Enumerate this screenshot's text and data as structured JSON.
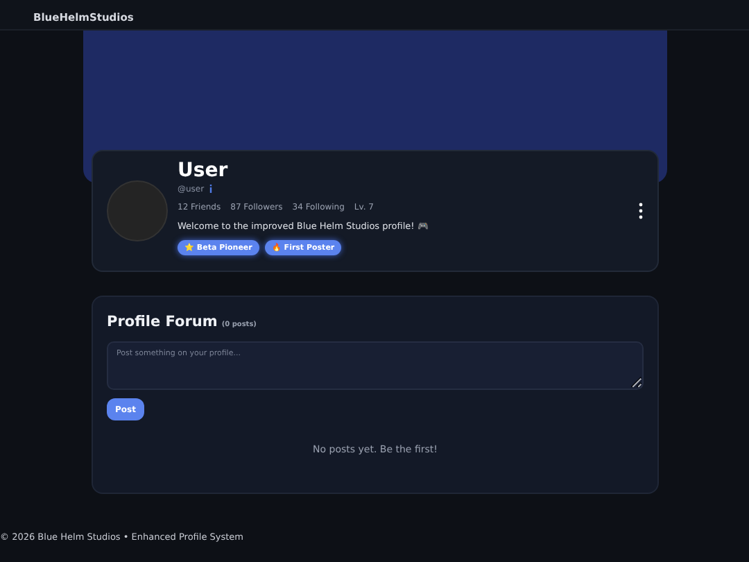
{
  "nav": {
    "brand": "BlueHelmStudios"
  },
  "profile": {
    "name": "User",
    "handle": "@user",
    "stats": [
      "12 Friends",
      "87 Followers",
      "34 Following",
      "Lv. 7"
    ],
    "bio": "Welcome to the improved Blue Helm Studios profile! 🎮",
    "badges": [
      {
        "label": "⭐ Beta Pioneer"
      },
      {
        "label": "🔥 First Poster"
      }
    ]
  },
  "forum": {
    "title": "Profile Forum",
    "count": "(0 posts)",
    "placeholder": "Post something on your profile...",
    "button": "Post",
    "empty": "No posts yet. Be the first!"
  },
  "footer": "© 2026 Blue Helm Studios • Enhanced Profile System"
}
